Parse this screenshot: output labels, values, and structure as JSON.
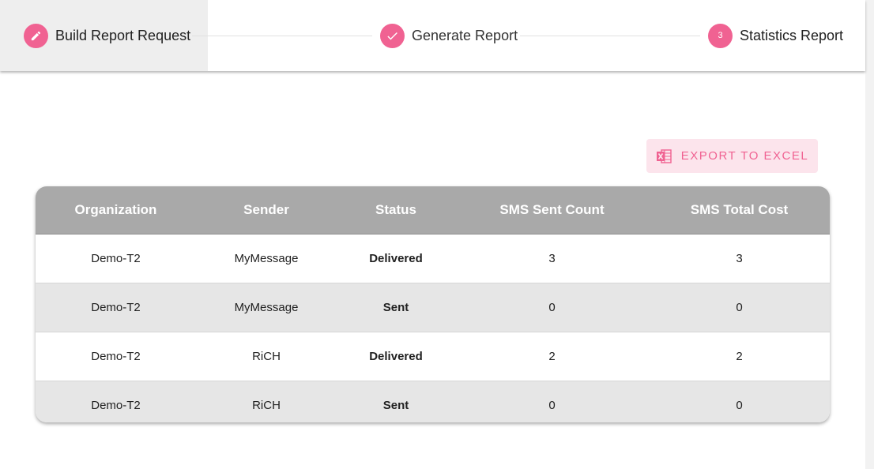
{
  "stepper": {
    "steps": [
      {
        "label": "Build Report Request",
        "icon": "pencil-icon"
      },
      {
        "label": "Generate Report",
        "icon": "check-icon"
      },
      {
        "label": "Statistics Report",
        "number": "3"
      }
    ]
  },
  "toolbar": {
    "export_label": "EXPORT TO EXCEL",
    "export_icon": "excel-icon"
  },
  "table": {
    "headers": [
      "Organization",
      "Sender",
      "Status",
      "SMS Sent Count",
      "SMS Total Cost"
    ],
    "rows": [
      [
        "Demo-T2",
        "MyMessage",
        "Delivered",
        "3",
        "3"
      ],
      [
        "Demo-T2",
        "MyMessage",
        "Sent",
        "0",
        "0"
      ],
      [
        "Demo-T2",
        "RiCH",
        "Delivered",
        "2",
        "2"
      ],
      [
        "Demo-T2",
        "RiCH",
        "Sent",
        "0",
        "0"
      ]
    ]
  },
  "colors": {
    "accent": "#f06292",
    "header_bg": "#a9a9a9",
    "export_bg": "#fce4ec"
  }
}
